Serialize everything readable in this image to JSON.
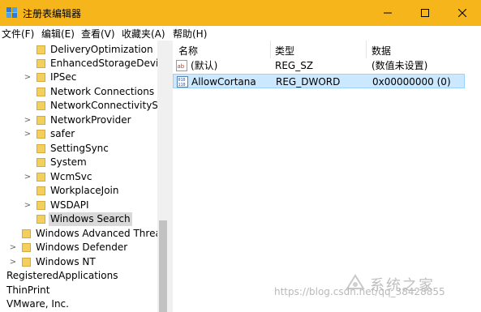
{
  "window": {
    "title": "注册表编辑器",
    "accent_color": "#f5b51b",
    "controls": [
      "minimize-icon",
      "maximize-icon",
      "close-icon"
    ]
  },
  "menu": {
    "items": [
      "文件(F)",
      "编辑(E)",
      "查看(V)",
      "收藏夹(A)",
      "帮助(H)"
    ]
  },
  "tree": {
    "rows": [
      {
        "label": "DeliveryOptimization",
        "expander": false
      },
      {
        "label": "EnhancedStorageDevic",
        "expander": false
      },
      {
        "label": "IPSec",
        "expander": true
      },
      {
        "label": "Network Connections",
        "expander": false
      },
      {
        "label": "NetworkConnectivityS",
        "expander": false
      },
      {
        "label": "NetworkProvider",
        "expander": true
      },
      {
        "label": "safer",
        "expander": true
      },
      {
        "label": "SettingSync",
        "expander": false
      },
      {
        "label": "System",
        "expander": false
      },
      {
        "label": "WcmSvc",
        "expander": true
      },
      {
        "label": "WorkplaceJoin",
        "expander": false
      },
      {
        "label": "WSDAPI",
        "expander": true
      },
      {
        "label": "Windows Search",
        "expander": false,
        "selected": true
      },
      {
        "label": "Windows Advanced Threa",
        "expander": false
      },
      {
        "label": "Windows Defender",
        "expander": true
      },
      {
        "label": "Windows NT",
        "expander": true
      },
      {
        "label": "RegisteredApplications",
        "expander": false
      },
      {
        "label": "ThinPrint",
        "expander": false
      },
      {
        "label": "VMware, Inc.",
        "expander": false
      }
    ]
  },
  "list": {
    "headers": [
      "名称",
      "类型",
      "数据"
    ],
    "rows": [
      {
        "name": "(默认)",
        "type": "REG_SZ",
        "data": "(数值未设置)",
        "icon": "string-value-icon",
        "selected": false
      },
      {
        "name": "AllowCortana",
        "type": "REG_DWORD",
        "data": "0x00000000 (0)",
        "icon": "dword-value-icon",
        "selected": true
      }
    ]
  },
  "watermark": {
    "url": "https://blog.csdn.net/qq_38428855",
    "brand": "系统之家"
  }
}
